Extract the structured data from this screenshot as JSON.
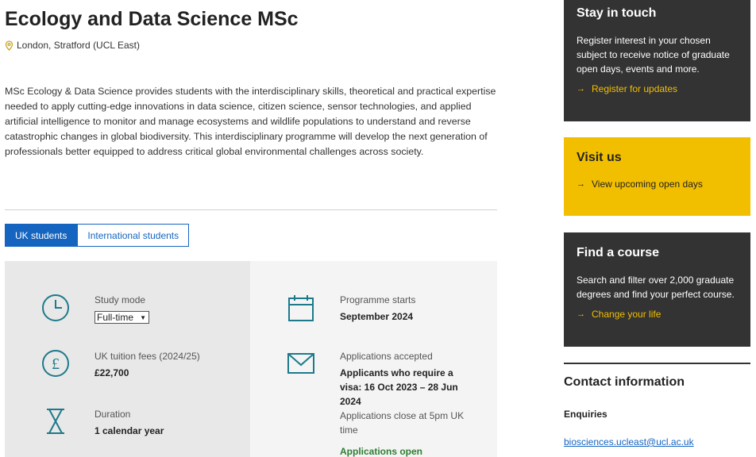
{
  "header": {
    "title": "Ecology and Data Science MSc",
    "location": "London, Stratford (UCL East)",
    "location_icon": "map-pin-icon"
  },
  "intro": "MSc Ecology & Data Science provides students with the interdisciplinary skills, theoretical and practical expertise needed to apply cutting-edge innovations in data science, citizen science, sensor technologies, and applied artificial intelligence to monitor and manage ecosystems and wildlife populations to understand and reverse catastrophic changes in global biodiversity. This interdisciplinary programme will develop the next generation of professionals better equipped to address critical global environmental challenges across society.",
  "tabs": [
    {
      "label": "UK students",
      "active": true
    },
    {
      "label": "International students",
      "active": false
    }
  ],
  "facts": {
    "study_mode": {
      "label": "Study mode",
      "selected": "Full-time",
      "icon": "clock-icon"
    },
    "fees": {
      "label": "UK tuition fees (2024/25)",
      "value": "£22,700",
      "icon": "pound-icon"
    },
    "duration": {
      "label": "Duration",
      "value": "1 calendar year",
      "icon": "hourglass-icon"
    },
    "programme_starts": {
      "label": "Programme starts",
      "value": "September 2024",
      "icon": "calendar-icon"
    },
    "applications": {
      "label": "Applications accepted",
      "value": "Applicants who require a visa: 16 Oct 2023 – 28 Jun 2024",
      "note": "Applications close at 5pm UK time",
      "status": "Applications open",
      "icon": "envelope-icon"
    }
  },
  "sidebar": {
    "stay_in_touch": {
      "title": "Stay in touch",
      "text": "Register interest in your chosen subject to receive notice of graduate open days, events and more.",
      "link": "Register for updates"
    },
    "visit_us": {
      "title": "Visit us",
      "link": "View upcoming open days"
    },
    "find_course": {
      "title": "Find a course",
      "text": "Search and filter over 2,000 graduate degrees and find your perfect course.",
      "link": "Change your life"
    },
    "contact": {
      "title": "Contact information",
      "enquiries_label": "Enquiries",
      "email": "biosciences.ucleast@ucl.ac.uk"
    }
  },
  "colors": {
    "accent_blue": "#1565c0",
    "teal_icon": "#1d7a8a",
    "dark_box": "#333333",
    "yellow_box": "#f2bf00",
    "status_green": "#2e7d32"
  }
}
